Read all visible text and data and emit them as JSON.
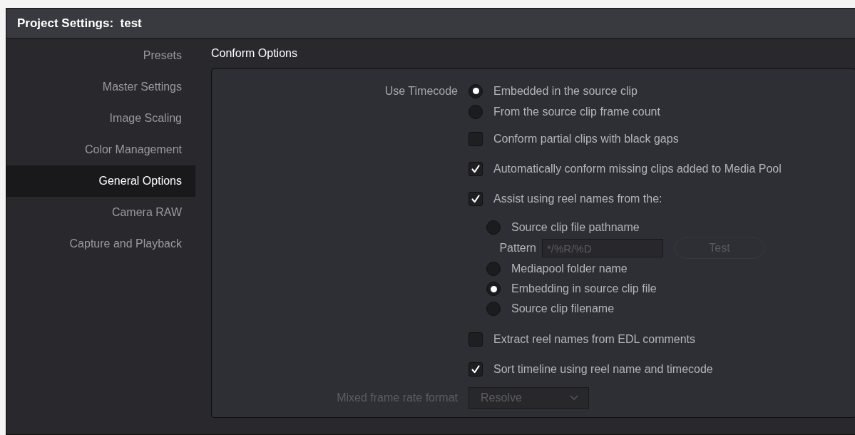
{
  "window": {
    "title": "Project Settings:  test"
  },
  "sidebar": {
    "items": [
      {
        "label": "Presets",
        "selected": false
      },
      {
        "label": "Master Settings",
        "selected": false
      },
      {
        "label": "Image Scaling",
        "selected": false
      },
      {
        "label": "Color Management",
        "selected": false
      },
      {
        "label": "General Options",
        "selected": true
      },
      {
        "label": "Camera RAW",
        "selected": false
      },
      {
        "label": "Capture and Playback",
        "selected": false
      }
    ]
  },
  "section": {
    "title": "Conform Options",
    "rows": [
      {
        "kind": "radio_group",
        "label": "Use Timecode",
        "options": [
          {
            "label": "Embedded in the source clip",
            "selected": true
          },
          {
            "label": "From the source clip frame count",
            "selected": false
          }
        ]
      },
      {
        "kind": "checkbox",
        "label": "Conform partial clips with black gaps",
        "checked": false
      },
      {
        "kind": "checkbox",
        "label": "Automatically conform missing clips added to Media Pool",
        "checked": true
      },
      {
        "kind": "checkbox",
        "label": "Assist using reel names from the:",
        "checked": true,
        "children": [
          {
            "kind": "radio",
            "label": "Source clip file pathname",
            "selected": false
          },
          {
            "kind": "pattern",
            "label": "Pattern",
            "value": "*/%R/%D",
            "button": "Test",
            "disabled": true
          },
          {
            "kind": "radio",
            "label": "Mediapool folder name",
            "selected": false
          },
          {
            "kind": "radio",
            "label": "Embedding in source clip file",
            "selected": true
          },
          {
            "kind": "radio",
            "label": "Source clip filename",
            "selected": false
          }
        ]
      },
      {
        "kind": "checkbox",
        "label": "Extract reel names from EDL comments",
        "checked": false
      },
      {
        "kind": "checkbox",
        "label": "Sort timeline using reel name and timecode",
        "checked": true
      },
      {
        "kind": "select",
        "label": "Mixed frame rate format",
        "value": "Resolve",
        "disabled": true
      }
    ]
  }
}
